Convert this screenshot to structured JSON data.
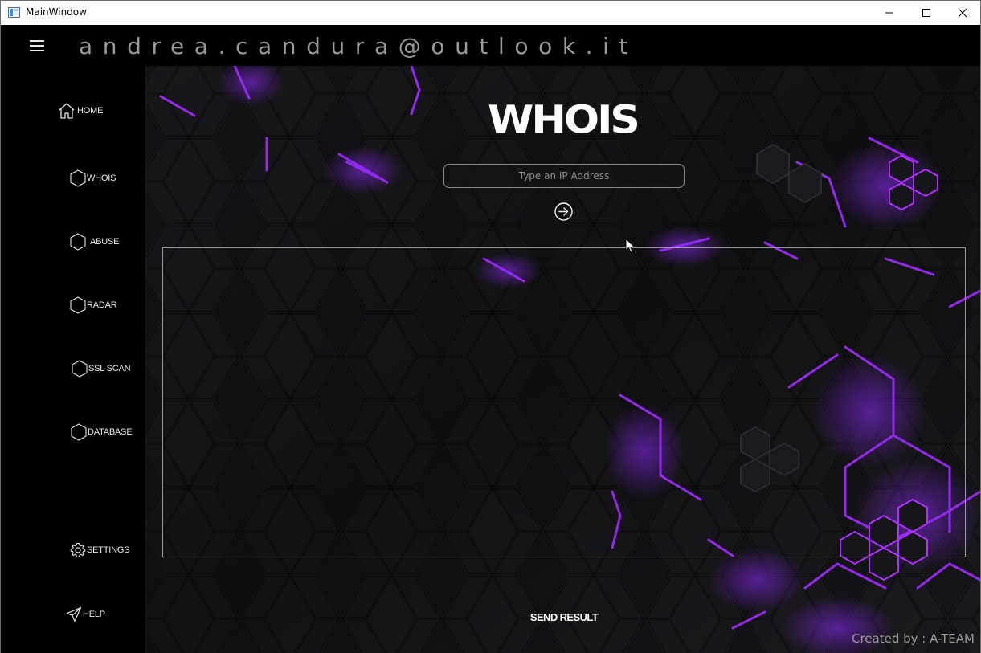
{
  "window": {
    "title": "MainWindow"
  },
  "header": {
    "email": "andrea.candura@outlook.it"
  },
  "sidebar": {
    "items": [
      {
        "label": "HOME",
        "icon": "home-icon"
      },
      {
        "label": "WHOIS",
        "icon": "hexagon-icon"
      },
      {
        "label": "ABUSE",
        "icon": "hexagon-icon"
      },
      {
        "label": "RADAR",
        "icon": "hexagon-icon"
      },
      {
        "label": "SSL SCAN",
        "icon": "hexagon-icon"
      },
      {
        "label": "DATABASE",
        "icon": "hexagon-icon"
      }
    ],
    "settings_label": "SETTINGS",
    "help_label": "HELP"
  },
  "main": {
    "logo_text": "WHOIS",
    "ip_placeholder": "Type an IP Address",
    "ip_value": "",
    "result_text": "",
    "send_label": "SEND RESULT",
    "credit": "Created by : A-TEAM"
  },
  "colors": {
    "accent": "#8a2be2",
    "background": "#000000",
    "text": "#eaeaea"
  }
}
